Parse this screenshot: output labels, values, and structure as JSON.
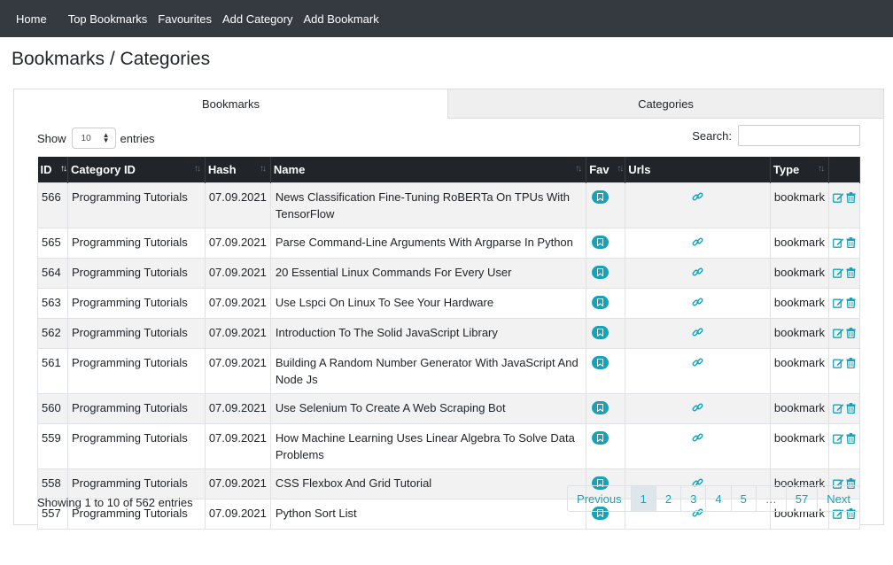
{
  "nav": {
    "items": [
      "Home",
      "Top Bookmarks",
      "Favourites",
      "Add Category",
      "Add Bookmark"
    ]
  },
  "page": {
    "title": "Bookmarks / Categories"
  },
  "tabs": [
    {
      "label": "Bookmarks",
      "active": true
    },
    {
      "label": "Categories",
      "active": false
    }
  ],
  "controls": {
    "show_label": "Show",
    "page_length": "10",
    "entries_label": "entries",
    "search_label": "Search:",
    "search_value": ""
  },
  "table": {
    "headers": [
      "ID",
      "Category ID",
      "Hash",
      "Name",
      "Fav",
      "Urls",
      "Type",
      ""
    ],
    "rows": [
      {
        "id": "566",
        "category": "Programming Tutorials",
        "hash": "07.09.2021",
        "name": "News Classification Fine-Tuning RoBERTa On TPUs With TensorFlow",
        "type": "bookmark"
      },
      {
        "id": "565",
        "category": "Programming Tutorials",
        "hash": "07.09.2021",
        "name": "Parse Command-Line Arguments With Argparse In Python",
        "type": "bookmark"
      },
      {
        "id": "564",
        "category": "Programming Tutorials",
        "hash": "07.09.2021",
        "name": "20 Essential Linux Commands For Every User",
        "type": "bookmark"
      },
      {
        "id": "563",
        "category": "Programming Tutorials",
        "hash": "07.09.2021",
        "name": "Use Lspci On Linux To See Your Hardware",
        "type": "bookmark"
      },
      {
        "id": "562",
        "category": "Programming Tutorials",
        "hash": "07.09.2021",
        "name": "Introduction To The Solid JavaScript Library",
        "type": "bookmark"
      },
      {
        "id": "561",
        "category": "Programming Tutorials",
        "hash": "07.09.2021",
        "name": "Building A Random Number Generator With JavaScript And Node Js",
        "type": "bookmark"
      },
      {
        "id": "560",
        "category": "Programming Tutorials",
        "hash": "07.09.2021",
        "name": "Use Selenium To Create A Web Scraping Bot",
        "type": "bookmark"
      },
      {
        "id": "559",
        "category": "Programming Tutorials",
        "hash": "07.09.2021",
        "name": "How Machine Learning Uses Linear Algebra To Solve Data Problems",
        "type": "bookmark"
      },
      {
        "id": "558",
        "category": "Programming Tutorials",
        "hash": "07.09.2021",
        "name": "CSS Flexbox And Grid Tutorial",
        "type": "bookmark"
      },
      {
        "id": "557",
        "category": "Programming Tutorials",
        "hash": "07.09.2021",
        "name": "Python Sort List",
        "type": "bookmark"
      }
    ]
  },
  "footer": {
    "info": "Showing 1 to 10 of 562 entries",
    "pages": [
      "Previous",
      "1",
      "2",
      "3",
      "4",
      "5",
      "…",
      "57",
      "Next"
    ],
    "current_page": "1"
  },
  "colors": {
    "accent": "#17a2b8",
    "navbar": "#343a40",
    "table_header": "#212529"
  },
  "icons": {
    "fav": "bookmark-icon",
    "url": "link-icon",
    "edit": "edit-icon",
    "delete": "trash-icon"
  }
}
